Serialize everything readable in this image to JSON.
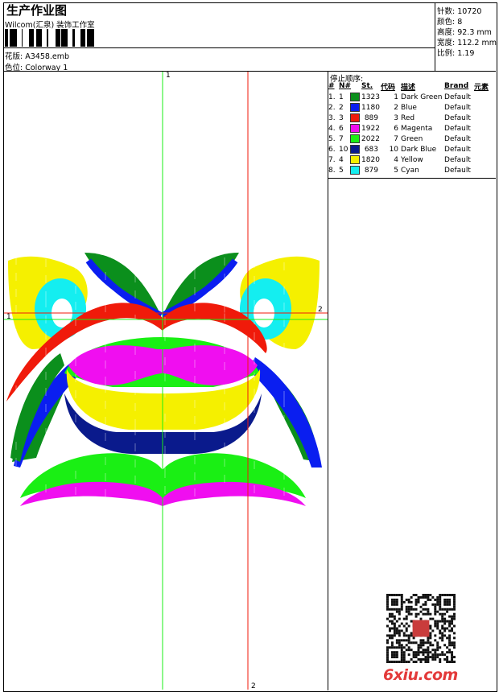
{
  "header": {
    "title": "生产作业图",
    "subtitle": "Wilcom(汇泉) 装饰工作室",
    "pattern_label": "花版:",
    "pattern_value": "A3458.emb",
    "colorway_label": "色位:",
    "colorway_value": "Colorway 1"
  },
  "stats": [
    {
      "label": "针数:",
      "value": "10720"
    },
    {
      "label": "颜色:",
      "value": "8"
    },
    {
      "label": "高度:",
      "value": "92.3 mm"
    },
    {
      "label": "宽度:",
      "value": "112.2 mm"
    },
    {
      "label": "比例:",
      "value": "1.19"
    }
  ],
  "stop_sequence": {
    "title": "停止顺序:",
    "columns": [
      "#",
      "N#",
      "St.",
      "代码",
      "描述",
      "Brand",
      "元素"
    ],
    "rows": [
      {
        "idx": "1.",
        "n": "1",
        "color": "#0b8f1c",
        "st": "1323",
        "code": "1",
        "desc": "Dark Green",
        "brand": "Default"
      },
      {
        "idx": "2.",
        "n": "2",
        "color": "#0a1ef0",
        "st": "1180",
        "code": "2",
        "desc": "Blue",
        "brand": "Default"
      },
      {
        "idx": "3.",
        "n": "3",
        "color": "#f01a0a",
        "st": "889",
        "code": "3",
        "desc": "Red",
        "brand": "Default"
      },
      {
        "idx": "4.",
        "n": "6",
        "color": "#f00ef0",
        "st": "1922",
        "code": "6",
        "desc": "Magenta",
        "brand": "Default"
      },
      {
        "idx": "5.",
        "n": "7",
        "color": "#1aef14",
        "st": "2022",
        "code": "7",
        "desc": "Green",
        "brand": "Default"
      },
      {
        "idx": "6.",
        "n": "10",
        "color": "#0a1a8c",
        "st": "683",
        "code": "10",
        "desc": "Dark Blue",
        "brand": "Default"
      },
      {
        "idx": "7.",
        "n": "4",
        "color": "#f5f000",
        "st": "1820",
        "code": "4",
        "desc": "Yellow",
        "brand": "Default"
      },
      {
        "idx": "8.",
        "n": "5",
        "color": "#14eef0",
        "st": "879",
        "code": "5",
        "desc": "Cyan",
        "brand": "Default"
      }
    ]
  },
  "guides": {
    "v1": "1",
    "v2": "2",
    "h1": "1",
    "h2": "2"
  },
  "watermark": "6xiu.com"
}
